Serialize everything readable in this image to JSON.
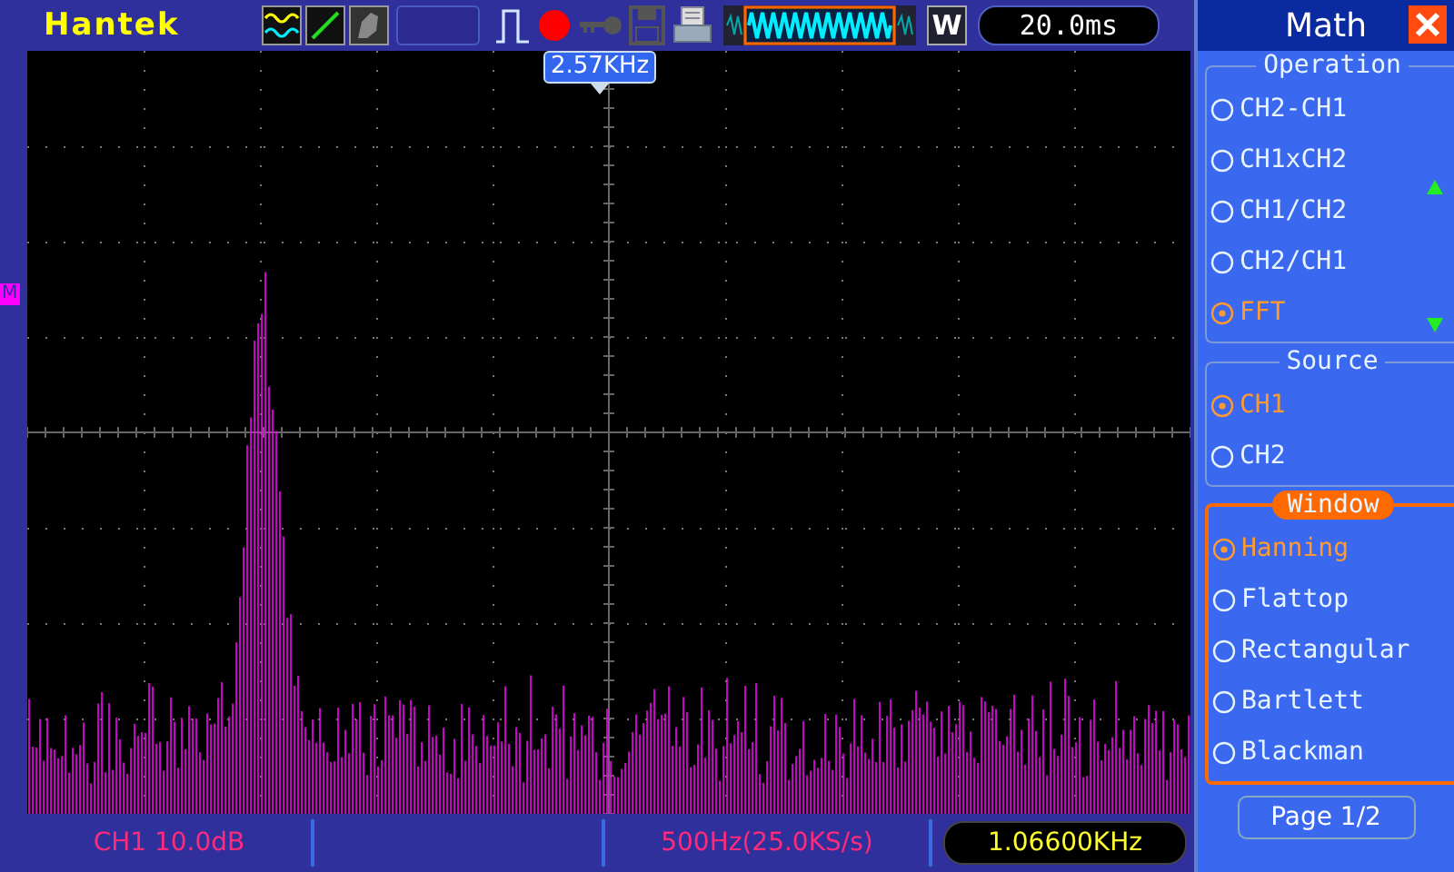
{
  "brand": "Hantek",
  "timebase": "20.0ms",
  "mode_key": "W",
  "cursor_label": "2.57KHz",
  "math_marker": "M",
  "panel": {
    "title": "Math",
    "groups": [
      {
        "title": "Operation",
        "active": false,
        "scroll_arrows": true,
        "options": [
          {
            "label": "CH2-CH1",
            "selected": false
          },
          {
            "label": "CH1xCH2",
            "selected": false
          },
          {
            "label": "CH1/CH2",
            "selected": false
          },
          {
            "label": "CH2/CH1",
            "selected": false
          },
          {
            "label": "FFT",
            "selected": true
          }
        ]
      },
      {
        "title": "Source",
        "active": false,
        "scroll_arrows": false,
        "options": [
          {
            "label": "CH1",
            "selected": true
          },
          {
            "label": "CH2",
            "selected": false
          }
        ]
      },
      {
        "title": "Window",
        "active": true,
        "scroll_arrows": false,
        "options": [
          {
            "label": "Hanning",
            "selected": true
          },
          {
            "label": "Flattop",
            "selected": false
          },
          {
            "label": "Rectangular",
            "selected": false
          },
          {
            "label": "Bartlett",
            "selected": false
          },
          {
            "label": "Blackman",
            "selected": false
          }
        ]
      }
    ],
    "page_button": "Page 1/2"
  },
  "status_bar": {
    "scale": "CH1 10.0dB",
    "sample_rate": "500Hz(25.0KS/s)",
    "frequency": "1.06600KHz"
  }
}
